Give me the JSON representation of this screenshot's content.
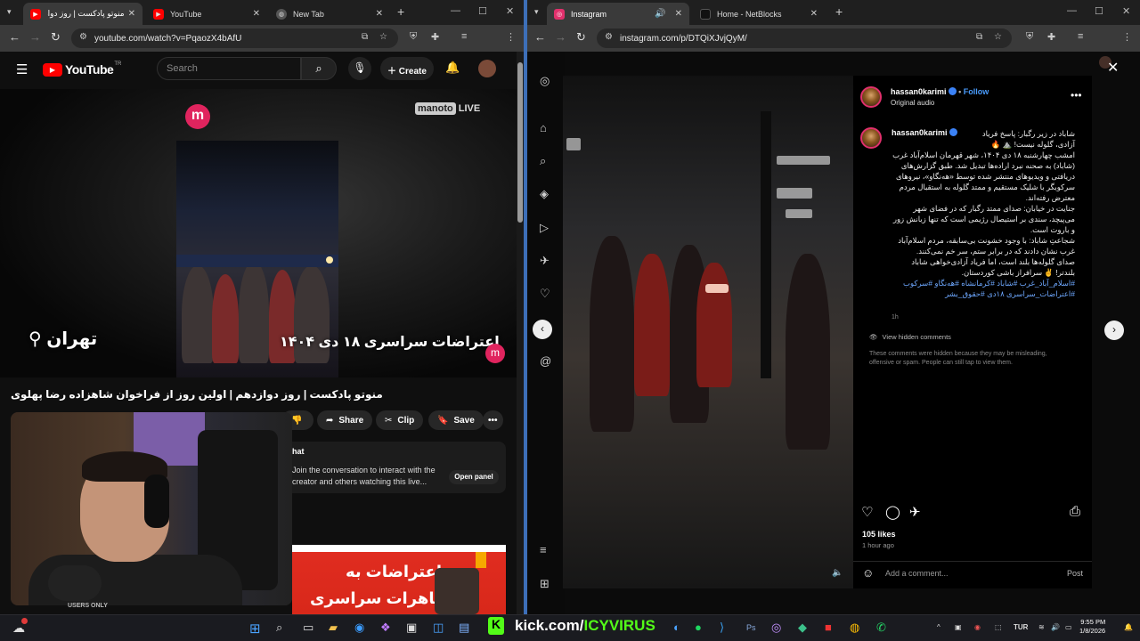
{
  "left_browser": {
    "tabs": [
      {
        "title": "منوتو پادکست | روز دوازد",
        "active": true,
        "favicon_color": "#ff0000"
      },
      {
        "title": "YouTube",
        "active": false,
        "favicon_color": "#ff0000"
      },
      {
        "title": "New Tab",
        "active": false,
        "favicon_color": "#9aa0a6"
      }
    ],
    "url": "youtube.com/watch?v=PqaozX4bAfU"
  },
  "youtube": {
    "logo_text": "YouTube",
    "logo_super": "TR",
    "search_placeholder": "Search",
    "create_label": "Create",
    "video": {
      "channel_watermark": "manoto",
      "live_badge": "LIVE",
      "location_text": "تهران",
      "headline_text": "اعتراضات سراسری ۱۸ دی ۱۴۰۴"
    },
    "title": "منوتو پادکست | روز دوازدهم | اولین روز از فراخوان شاهزاده رضا پهلوی",
    "actions": {
      "share": "Share",
      "clip": "Clip",
      "save": "Save"
    },
    "chat": {
      "header": "hat",
      "message": "Join the conversation to interact with the creator and others watching this live...",
      "open_panel": "Open panel"
    },
    "thumbnail": {
      "line1": "اعتراضات به",
      "line2": "تظاهرات سراسری"
    },
    "webcam_caption": "USERS ONLY"
  },
  "right_browser": {
    "tabs": [
      {
        "title": "Instagram",
        "active": true,
        "favicon_color": "#e1306c"
      },
      {
        "title": "Home - NetBlocks",
        "active": false,
        "favicon_color": "#111111"
      }
    ],
    "url": "instagram.com/p/DTQiXJvjQyM/"
  },
  "instagram": {
    "username": "hassan0karimi",
    "follow_label": "Follow",
    "audio_label": "Original audio",
    "caption": [
      "شاباد در زیر رگبار: پاسخ فریاد آزادی، گلوله نیست! ⛰️ 🔥",
      "امشب چهارشنبه ۱۸ دی ۱۴۰۴، شهر قهرمان اسلام‌آباد غرب (شاباد) به صحنه نبرد اراده‌ها تبدیل شد. طبق گزارش‌های دریافتی و ویدیوهای منتشر شده توسط «هه‌نگاو»، نیروهای سرکوبگر با شلیک مستقیم و ممتد گلوله به استقبال مردم معترض رفته‌اند.",
      "جنایت در خیابان: صدای ممتد رگبار که در فضای شهر می‌پیچد، سندی بر استیصال رژیمی است که تنها زبانش زور و باروت است.",
      "شجاعتِ شاباد: با وجود خشونت بی‌سابقه، مردم اسلام‌آباد غرب نشان دادند که در برابر ستم، سر خم نمی‌کنند.",
      "صدای گلوله‌ها بلند است، اما فریاد آزادی‌خواهی شاباد بلندتر! ✌️ سرافراز باشی کوردستان."
    ],
    "hashtags": "#اسلام_آباد_غرب #شاباد #کرمانشاه #هه‌نگاو #سرکوب #اعتراضات_سراسری ۱۸دی #حقوق_بشر",
    "caption_age": "1h",
    "view_hidden": "View hidden comments",
    "hidden_msg": "These comments were hidden because they may be misleading, offensive or spam. People can still tap to view them.",
    "likes": "105 likes",
    "posted_ago": "1 hour ago",
    "comment_placeholder": "Add a comment...",
    "post_label": "Post"
  },
  "taskbar": {
    "kick_prefix": "kick.com/",
    "kick_user": "ICYVIRUS",
    "language": "TUR",
    "time": "9:55 PM",
    "date": "1/8/2026"
  },
  "colors": {
    "youtube_red": "#ff0000",
    "manoto_pink": "#e0245e",
    "instagram_link": "#6ea8ff",
    "kick_green": "#53fc18",
    "window_divider": "#3d6fb8"
  }
}
